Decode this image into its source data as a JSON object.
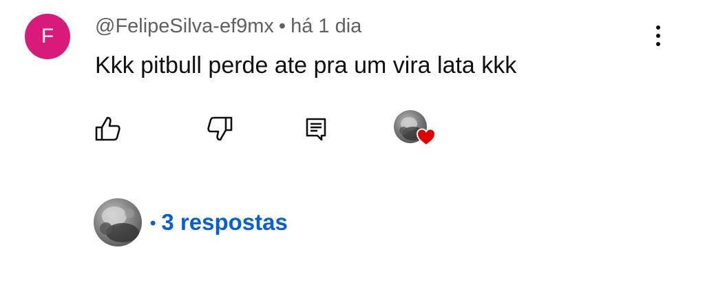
{
  "comment": {
    "avatar_letter": "F",
    "avatar_color": "#d81b7a",
    "author": "@FelipeSilva-ef9mx",
    "separator": "•",
    "time": "há 1 dia",
    "text": "Kkk pitbull perde ate pra um vira lata kkk",
    "menu_icon": "more-vertical-icon"
  },
  "actions": {
    "like_icon": "thumb-up-icon",
    "dislike_icon": "thumb-down-icon",
    "reply_icon": "comment-icon",
    "creator_heart_icon": "heart-icon",
    "heart_color": "#e00000"
  },
  "replies": {
    "bullet": "•",
    "label": "3 respostas",
    "link_color": "#065fd4"
  }
}
